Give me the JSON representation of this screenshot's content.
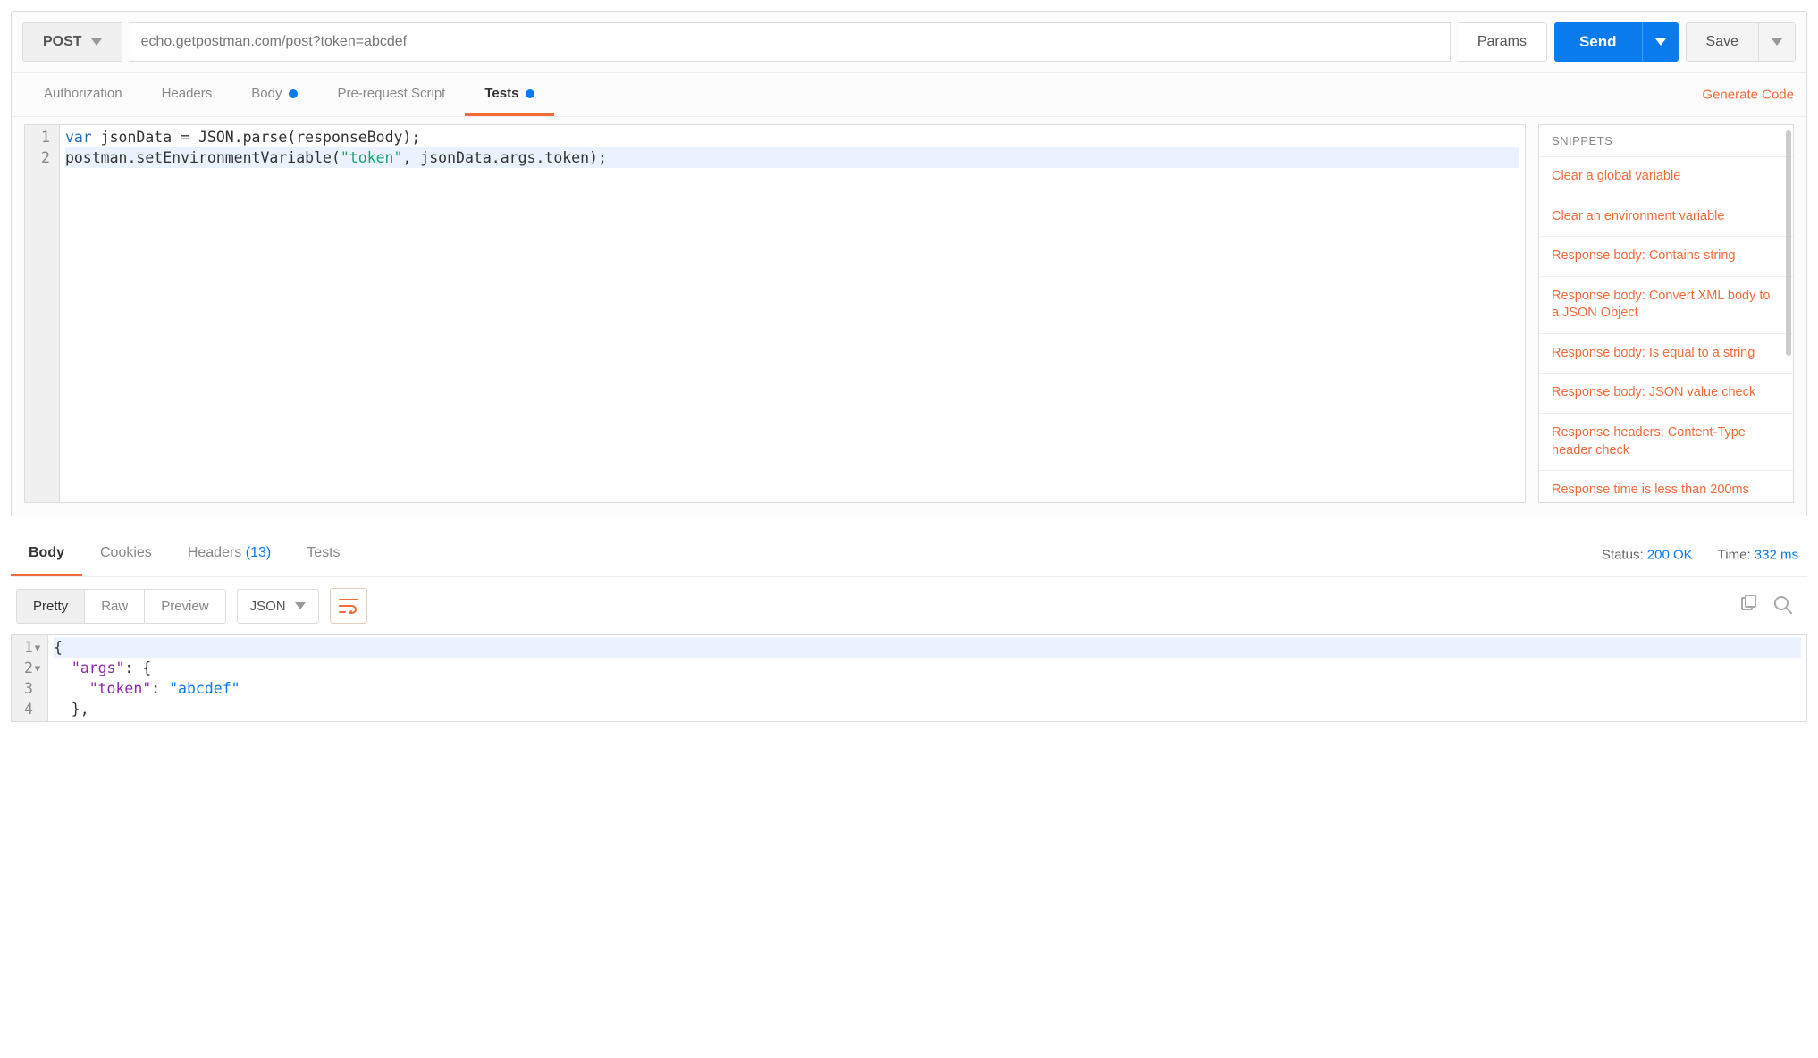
{
  "request": {
    "method": "POST",
    "url": "echo.getpostman.com/post?token=abcdef",
    "params_label": "Params",
    "send_label": "Send",
    "save_label": "Save",
    "tabs": [
      {
        "label": "Authorization",
        "dot": false,
        "active": false
      },
      {
        "label": "Headers",
        "dot": false,
        "active": false
      },
      {
        "label": "Body",
        "dot": true,
        "active": false
      },
      {
        "label": "Pre-request Script",
        "dot": false,
        "active": false
      },
      {
        "label": "Tests",
        "dot": true,
        "active": true
      }
    ],
    "generate_code_label": "Generate Code"
  },
  "tests_code": {
    "lines": [
      {
        "n": "1",
        "plain": "var jsonData = JSON.parse(responseBody);",
        "kw": "var"
      },
      {
        "n": "2",
        "plain": "postman.setEnvironmentVariable(\"token\", jsonData.args.token);",
        "str": "\"token\""
      }
    ]
  },
  "snippets": {
    "title": "SNIPPETS",
    "items": [
      "Clear a global variable",
      "Clear an environment variable",
      "Response body: Contains string",
      "Response body: Convert XML body to a JSON Object",
      "Response body: Is equal to a string",
      "Response body: JSON value check",
      "Response headers: Content-Type header check",
      "Response time is less than 200ms"
    ]
  },
  "response": {
    "tabs": {
      "body": "Body",
      "cookies": "Cookies",
      "headers": "Headers",
      "headers_count": "(13)",
      "tests": "Tests"
    },
    "status_label": "Status:",
    "status_value": "200 OK",
    "time_label": "Time:",
    "time_value": "332 ms",
    "view_modes": {
      "pretty": "Pretty",
      "raw": "Raw",
      "preview": "Preview"
    },
    "format": "JSON",
    "body_lines": [
      {
        "n": "1",
        "text": "{",
        "fold": true
      },
      {
        "n": "2",
        "text": "  \"args\": {",
        "fold": true
      },
      {
        "n": "3",
        "text": "    \"token\": \"abcdef\""
      },
      {
        "n": "4",
        "text": "  },"
      }
    ]
  }
}
